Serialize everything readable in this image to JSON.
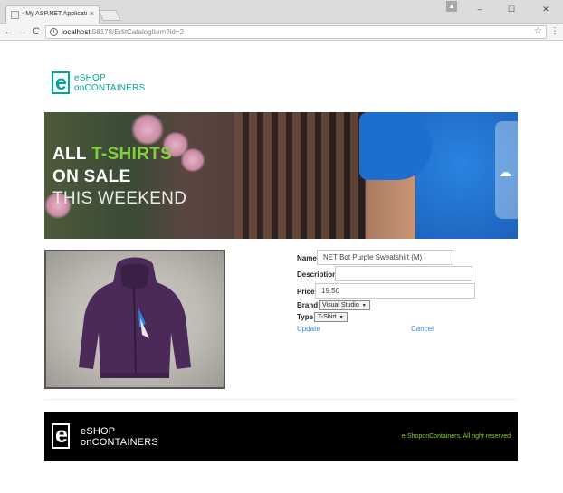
{
  "browser": {
    "tab_title": "- My ASP.NET Applicatio",
    "tab_close": "×",
    "profile_label": "▲",
    "minimize": "–",
    "maximize": "☐",
    "close": "✕",
    "back": "←",
    "forward": "→",
    "reload": "C",
    "url_host": "localhost",
    "url_path": ":58178/EditCatalogItem?id=2",
    "bookmark": "☆",
    "menu": "⋮"
  },
  "logo": {
    "mark": "e",
    "line1": "eSHOP",
    "line2": "onCONTAINERS"
  },
  "hero": {
    "line1_a": "ALL ",
    "line1_b": "T-SHIRTS",
    "line2": "ON SALE",
    "line3": "THIS WEEKEND",
    "accent_color": "#83d13a"
  },
  "form": {
    "name_label": "Name",
    "name_value": "NET Bot Purple Sweatshirt (M)",
    "description_label": "Description",
    "description_value": "",
    "price_label": "Price",
    "price_value": "19.50",
    "brand_label": "Brand",
    "brand_value": "Visual Studio",
    "type_label": "Type",
    "type_value": "T-Shirt",
    "update_link": "Update",
    "cancel_link": "Cancel",
    "link_color": "#3a86c8"
  },
  "footer": {
    "mark": "e",
    "line1": "eSHOP",
    "line2": "onCONTAINERS",
    "copyright": "e-ShoponContainers. All right reserved"
  },
  "colors": {
    "brand": "#00a69c",
    "footer_bg": "#000000"
  }
}
